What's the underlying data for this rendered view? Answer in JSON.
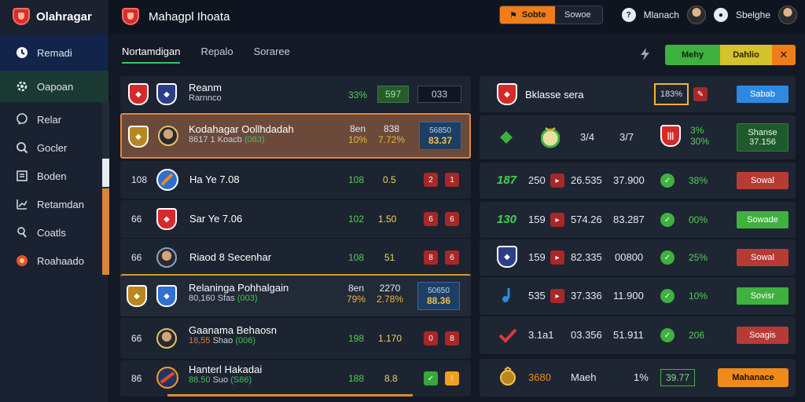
{
  "app": {
    "sidebar_title": "Olahragar",
    "title": "Mahagpl Ihoata"
  },
  "sidebar": {
    "items": [
      {
        "label": "Remadi",
        "icon": "clock-icon"
      },
      {
        "label": "Oapoan",
        "icon": "gear-icon"
      },
      {
        "label": "Relar",
        "icon": "chat-icon"
      },
      {
        "label": "Gocler",
        "icon": "search-icon"
      },
      {
        "label": "Boden",
        "icon": "document-icon"
      },
      {
        "label": "Retamdan",
        "icon": "chart-icon"
      },
      {
        "label": "Coatls",
        "icon": "location-icon"
      },
      {
        "label": "Roahaado",
        "icon": "ball-icon"
      }
    ]
  },
  "topbar": {
    "pill_primary": "Sobte",
    "pill_secondary": "Sowoe",
    "user1": "Mlanach",
    "user2": "Sbelghe"
  },
  "tabs": [
    "Nortamdigan",
    "Repalo",
    "Soraree"
  ],
  "toolbar": {
    "green": "Mehy",
    "yellow": "Dahlio",
    "close": "✕"
  },
  "left_rows": [
    {
      "name": "Reanm",
      "sub": "Rarnnco",
      "col1": "33%",
      "chip1": "597",
      "chip2": "033"
    },
    {
      "name": "Kodahagar Oollhdadah",
      "sub_a": "8617 1",
      "sub_b": "Koacb",
      "sub_c": "(083)",
      "top1": "8en",
      "top2": "838",
      "col1": "10%",
      "col2": "7.72%",
      "chip_top": "56850",
      "chip_bottom": "83.37"
    },
    {
      "num": "108",
      "name": "Ha Ye 7.08",
      "col1": "108",
      "col2": "0.5",
      "m1": "2",
      "m2": "1"
    },
    {
      "num": "66",
      "name": "Sar Ye 7.06",
      "col1": "102",
      "col2": "1.50",
      "m1": "6",
      "m2": "6"
    },
    {
      "num": "66",
      "name": "Riaod 8 Secenhar",
      "col1": "108",
      "col2": "51",
      "m1": "8",
      "m2": "6"
    },
    {
      "name": "Relaninga Pohhalgain",
      "sub_a": "80,160",
      "sub_b": "Sfas",
      "sub_c": "(003)",
      "top1": "8en",
      "top2": "2270",
      "col1": "79%",
      "col2": "2.78%",
      "chip_top": "50650",
      "chip_bottom": "88.36"
    },
    {
      "num": "66",
      "name": "Gaanama Behaosn",
      "sub_a": "18,55",
      "sub_b": "Shao",
      "sub_c": "(006)",
      "col1": "198",
      "col2": "1.170",
      "m1": "0",
      "m2": "8"
    },
    {
      "num": "86",
      "name": "Hanterl Hakadai",
      "sub_a": "88.50",
      "sub_b": "Suo",
      "sub_c": "(S86)",
      "col1": "188",
      "col2": "8.8",
      "m1": "✓",
      "m2": "!"
    }
  ],
  "right_rows": [
    {
      "label": "Bklasse sera",
      "box": "183%",
      "btn": "Sabab"
    },
    {
      "c1": "3/4",
      "c2": "3/7",
      "c3": "3%",
      "c4": "30%",
      "btn_top": "Shanse",
      "btn_bottom": "37.156"
    },
    {
      "tag": "187",
      "n1": "250",
      "n2": "26.535",
      "n3": "37.900",
      "pct": "38%",
      "btn": "Sowal"
    },
    {
      "tag": "130",
      "n1": "159",
      "n2": "574.26",
      "n3": "83.287",
      "pct": "00%",
      "btn": "Sowade"
    },
    {
      "n1": "159",
      "n2": "82.335",
      "n3": "00800",
      "pct": "25%",
      "btn": "Sowal"
    },
    {
      "n1": "535",
      "n2": "37.336",
      "n3": "11.900",
      "pct": "10%",
      "btn": "Sovisr"
    },
    {
      "n1": "3.1a1",
      "n2": "03.356",
      "n3": "51.911",
      "pct": "206",
      "btn": "Soagis"
    },
    {
      "n1": "3680",
      "n2": "Maeh",
      "n3": "1%",
      "box": "39.77",
      "btn": "Mahanace"
    }
  ],
  "colors": {
    "accent_orange": "#f07d1a",
    "accent_green": "#3fb13f",
    "accent_blue": "#2d8ae0"
  }
}
